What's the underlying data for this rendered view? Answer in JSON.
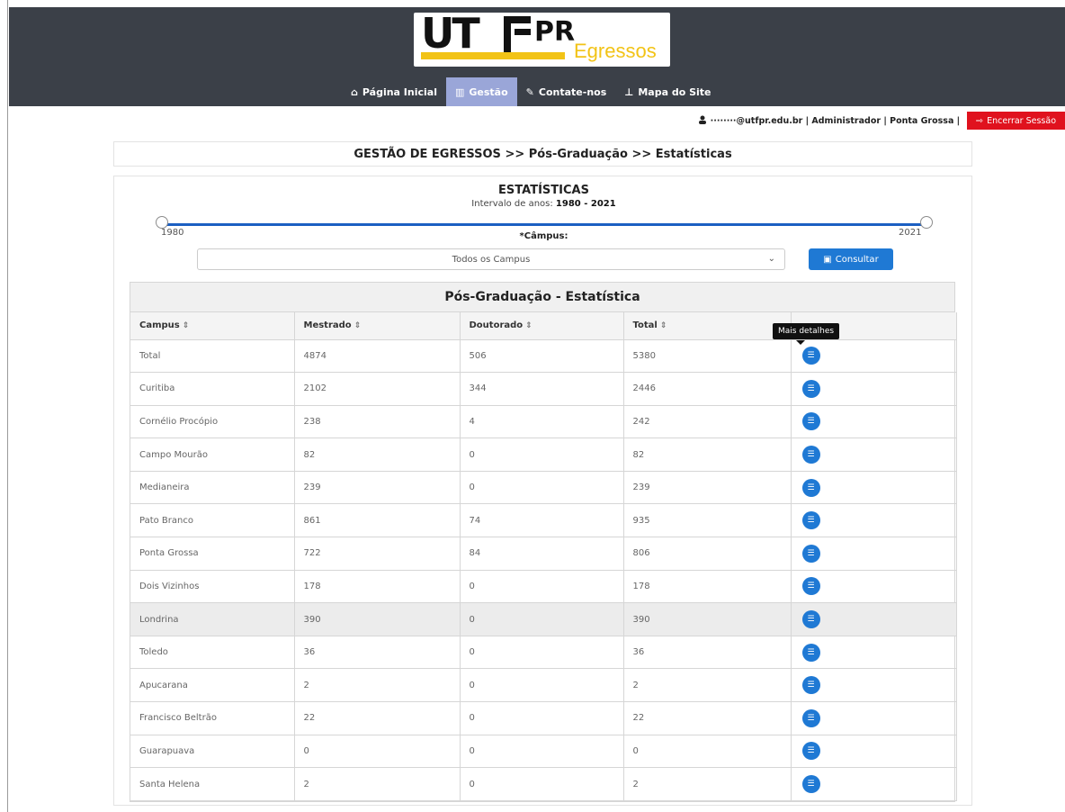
{
  "logo": {
    "main": "UT",
    "pr": "PR",
    "suffix": "Egressos"
  },
  "nav": [
    {
      "icon": "home-icon",
      "glyph": "⌂",
      "label": "Página Inicial",
      "active": false
    },
    {
      "icon": "institution-icon",
      "glyph": "▥",
      "label": "Gestão",
      "active": true
    },
    {
      "icon": "edit-icon",
      "glyph": "✎",
      "label": "Contate-nos",
      "active": false
    },
    {
      "icon": "sitemap-icon",
      "glyph": "⊥",
      "label": "Mapa do Site",
      "active": false
    }
  ],
  "user": {
    "info": "········@utfpr.edu.br | Administrador | Ponta Grossa |",
    "logout_label": "Encerrar Sessão"
  },
  "breadcrumb": "GESTÃO DE EGRESSOS >> Pós-Graduação >> Estatísticas",
  "stats": {
    "title": "ESTATÍSTICAS",
    "range_prefix": "Intervalo de anos:",
    "range_value": "1980 - 2021",
    "slider_min": "1980",
    "slider_max": "2021",
    "campus_label": "*Câmpus:",
    "campus_selected": "Todos os Campus",
    "consultar_label": "Consultar"
  },
  "table": {
    "caption": "Pós-Graduação - Estatística",
    "columns": [
      "Campus",
      "Mestrado",
      "Doutorado",
      "Total"
    ],
    "tooltip": "Mais detalhes",
    "rows": [
      [
        "Total",
        "4874",
        "506",
        "5380"
      ],
      [
        "Curitiba",
        "2102",
        "344",
        "2446"
      ],
      [
        "Cornélio Procópio",
        "238",
        "4",
        "242"
      ],
      [
        "Campo Mourão",
        "82",
        "0",
        "82"
      ],
      [
        "Medianeira",
        "239",
        "0",
        "239"
      ],
      [
        "Pato Branco",
        "861",
        "74",
        "935"
      ],
      [
        "Ponta Grossa",
        "722",
        "84",
        "806"
      ],
      [
        "Dois Vizinhos",
        "178",
        "0",
        "178"
      ],
      [
        "Londrina",
        "390",
        "0",
        "390"
      ],
      [
        "Toledo",
        "36",
        "0",
        "36"
      ],
      [
        "Apucarana",
        "2",
        "0",
        "2"
      ],
      [
        "Francisco Beltrão",
        "22",
        "0",
        "22"
      ],
      [
        "Guarapuava",
        "0",
        "0",
        "0"
      ],
      [
        "Santa Helena",
        "2",
        "0",
        "2"
      ]
    ]
  },
  "colors": {
    "header": "#3b4048",
    "accent": "#1f79d4",
    "danger": "#e0121e",
    "nav_active": "#9aa6d8"
  }
}
